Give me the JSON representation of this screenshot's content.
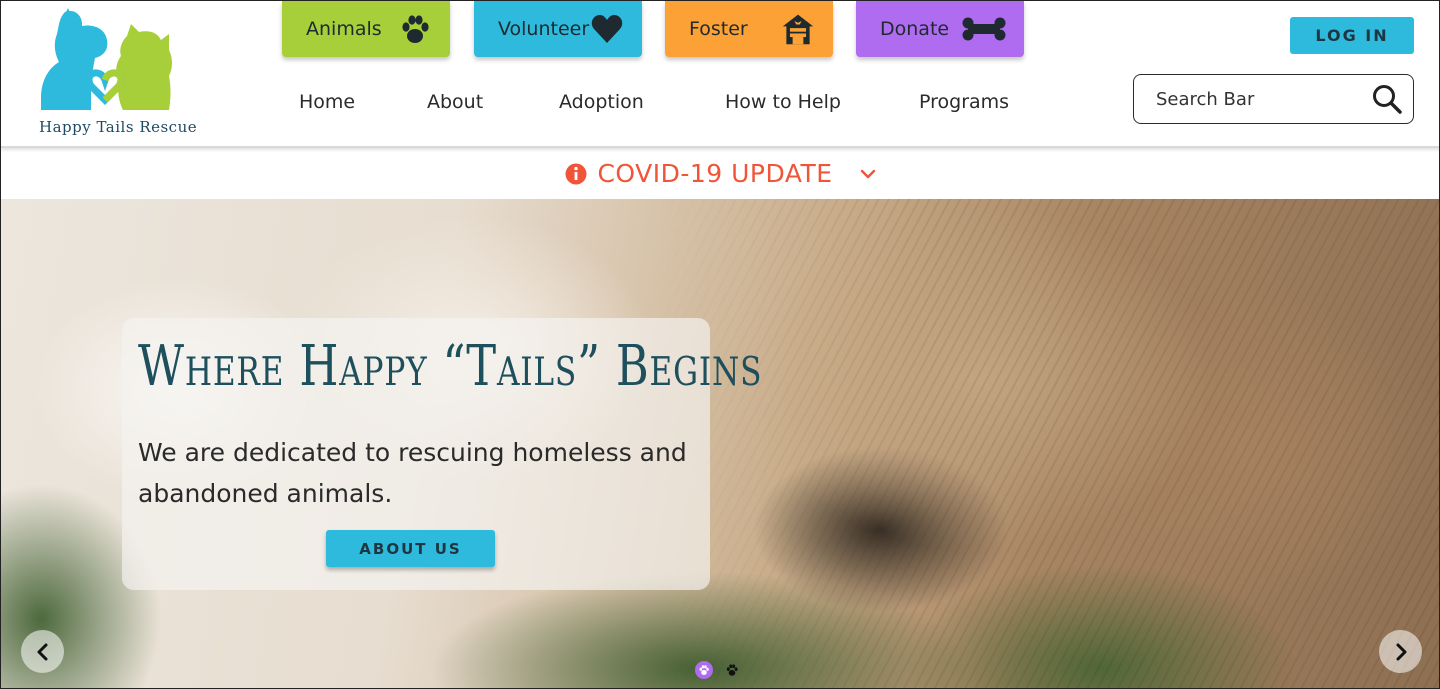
{
  "logo": {
    "text": "Happy Tails Rescue",
    "colors": {
      "dog": "#2ebadc",
      "cat": "#a6cf3a"
    }
  },
  "quick_nav": [
    {
      "label": "Animals",
      "icon": "paw-icon",
      "color": "#a6cf3a"
    },
    {
      "label": "Volunteer",
      "icon": "heart-icon",
      "color": "#2ebadc"
    },
    {
      "label": "Foster",
      "icon": "house-icon",
      "color": "#fba135"
    },
    {
      "label": "Donate",
      "icon": "bone-icon",
      "color": "#b06cf0"
    }
  ],
  "main_nav": [
    "Home",
    "About",
    "Adoption",
    "How to Help",
    "Programs"
  ],
  "login": {
    "label": "LOG IN"
  },
  "search": {
    "placeholder": "Search Bar",
    "icon": "search-icon"
  },
  "covid": {
    "label": "COVID-19 UPDATE",
    "icon": "info-icon",
    "color": "#f0553a"
  },
  "hero": {
    "title": "Where Happy “Tails” Begins",
    "subtitle": "We are dedicated to rescuing homeless and abandoned animals.",
    "button": "ABOUT US"
  },
  "carousel": {
    "slides": 2,
    "active_slide": 1
  }
}
